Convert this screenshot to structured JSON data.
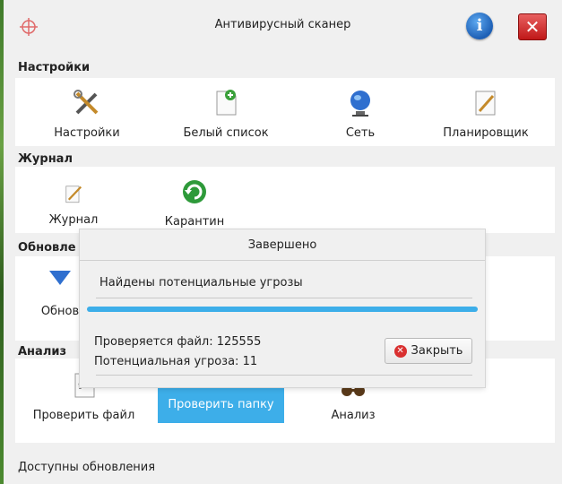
{
  "window": {
    "title": "Антивирусный сканер",
    "info_label": "i",
    "close_label": "✕"
  },
  "sections": {
    "settings": {
      "header": "Настройки",
      "items": [
        "Настройки",
        "Белый список",
        "Сеть",
        "Планировщик"
      ]
    },
    "journal": {
      "header": "Журнал",
      "items": [
        "Журнал",
        "Карантин"
      ]
    },
    "updates": {
      "header": "Обновле",
      "items": [
        "Обнов"
      ]
    },
    "analysis": {
      "header": "Анализ",
      "items": [
        "Проверить файл",
        "Проверить папку",
        "Анализ"
      ]
    }
  },
  "status_text": "Доступны обновления",
  "dialog": {
    "title": "Завершено",
    "message": "Найдены потенциальные угрозы",
    "progress": 1.0,
    "file_label": "Проверяется файл: 125555",
    "threat_label": "Потенциальная угроза: 11",
    "close_button": "Закрыть"
  },
  "colors": {
    "accent": "#3daee9",
    "background": "#f0f0f0",
    "panel": "#ffffff"
  },
  "icons": [
    "crosshair-icon",
    "info-icon",
    "close-icon",
    "tools-icon",
    "whitelist-icon",
    "network-globe-icon",
    "scheduler-icon",
    "journal-icon",
    "quarantine-icon",
    "update-icon",
    "file-scan-icon",
    "folder-scan-icon",
    "analysis-icon"
  ]
}
